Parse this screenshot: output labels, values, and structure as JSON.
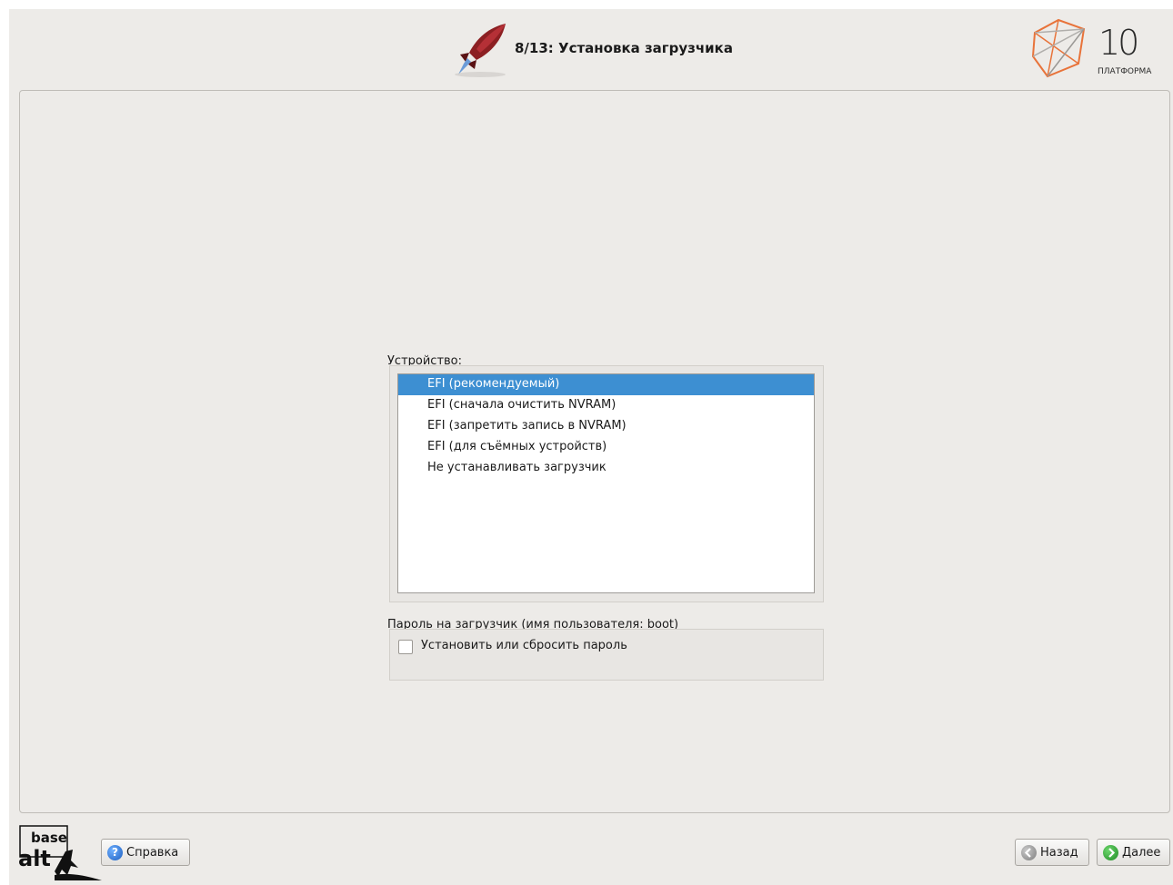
{
  "header": {
    "title": "8/13: Установка загрузчика",
    "brand": {
      "number": "10",
      "name": "ПЛАТФОРМА"
    }
  },
  "device": {
    "label": "Устройство:",
    "options": [
      "EFI (рекомендуемый)",
      "EFI (сначала очистить NVRAM)",
      "EFI (запретить запись в NVRAM)",
      "EFI (для съёмных устройств)",
      "Не устанавливать загрузчик"
    ],
    "selected": "EFI (рекомендуемый)"
  },
  "password": {
    "label": "Пароль на загрузчик (имя пользователя: boot)",
    "checkbox_label": "Установить или сбросить пароль",
    "checked": false
  },
  "footer": {
    "logo": {
      "line1": "base",
      "line2": "alt"
    },
    "help_label": "Справка",
    "back_label": "Назад",
    "next_label": "Далее"
  },
  "colors": {
    "window_bg": "#edebe8",
    "selection": "#3d8fd2",
    "brand_accent": "#e8733a"
  }
}
